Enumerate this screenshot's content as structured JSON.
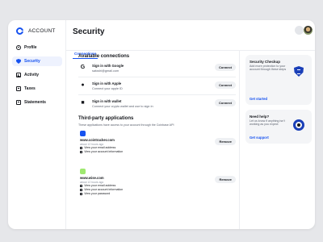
{
  "app": {
    "name": "ACCOUNT"
  },
  "sidebar": {
    "items": [
      {
        "label": "Profile",
        "icon": "user-icon",
        "active": false
      },
      {
        "label": "Security",
        "icon": "shield-icon",
        "active": true
      },
      {
        "label": "Activity",
        "icon": "activity-icon",
        "active": false
      },
      {
        "label": "Taxes",
        "icon": "taxes-icon",
        "active": false
      },
      {
        "label": "Statements",
        "icon": "statements-icon",
        "active": false
      }
    ]
  },
  "header": {
    "title": "Security"
  },
  "tabs": [
    {
      "label": "Connections",
      "active": true
    }
  ],
  "connections": {
    "title": "Available connections",
    "items": [
      {
        "icon": "google-icon",
        "name": "Sign in with Google",
        "detail": "satoshi@gmail.com",
        "button": "Connect"
      },
      {
        "icon": "apple-icon",
        "name": "Sign in with Apple",
        "detail": "Connect your apple ID",
        "button": "Connect"
      },
      {
        "icon": "wallet-icon",
        "name": "Sign in with wallet",
        "detail": "Connect your crypto wallet and use to sign in",
        "button": "Connect"
      }
    ]
  },
  "third_party": {
    "title": "Third-party applications",
    "subtitle": "These applications have access to your account through the Coinbase API",
    "apps": [
      {
        "icon": "cointracker-icon",
        "name": "www.cointracker.com",
        "time": "about 12 hours ago",
        "permissions": [
          "View your email address",
          "View your account information"
        ],
        "button": "Remove"
      },
      {
        "icon": "wise-icon",
        "name": "www.wise.com",
        "time": "about 12 hours ago",
        "permissions": [
          "View your email address",
          "View your account information",
          "View your password"
        ],
        "button": "Remove"
      }
    ]
  },
  "cards": {
    "checkup": {
      "title": "Security Checkup",
      "body": "Add more protection to your account through these steps",
      "link": "Get started",
      "art": "shield-art-icon"
    },
    "help": {
      "title": "Need help?",
      "body": "Let us know if anything isn't working as you expect",
      "link": "Get support",
      "art": "lifebuoy-art-icon"
    }
  },
  "colors": {
    "accent": "#1652f0",
    "card_bg": "#f4f5f7",
    "page_bg": "#e6e7ea"
  }
}
